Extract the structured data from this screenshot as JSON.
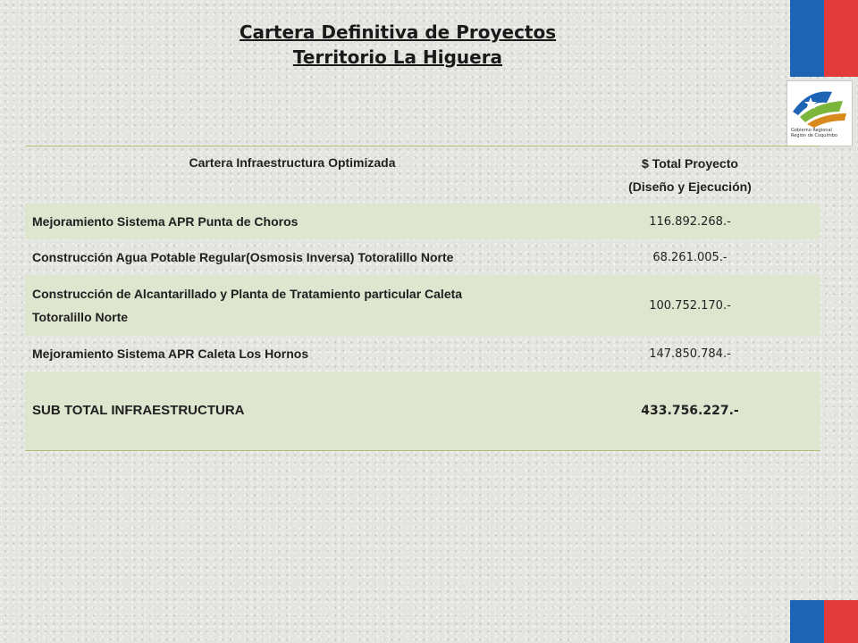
{
  "title": {
    "line1": "Cartera Definitiva de Proyectos",
    "line2": "Territorio La Higuera"
  },
  "logo": {
    "icon": "gobierno-regional-logo",
    "text": "Gobierno Regional Región de Coquimbo"
  },
  "colors": {
    "flag_blue": "#1d64b4",
    "flag_red": "#e23b3b",
    "row_shade": "#dfe6cf",
    "border": "#a9c07b"
  },
  "table": {
    "headers": {
      "name": "Cartera Infraestructura Optimizada",
      "value_line1": "$ Total Proyecto",
      "value_line2": "(Diseño y Ejecución)"
    },
    "rows": [
      {
        "name": "Mejoramiento Sistema APR Punta de Choros",
        "value": "116.892.268.-"
      },
      {
        "name": "Construcción Agua Potable Regular(Osmosis Inversa) Totoralillo Norte",
        "value": "68.261.005.-"
      },
      {
        "name_line1": "Construcción de Alcantarillado y Planta de Tratamiento particular Caleta",
        "name_line2": "Totoralillo Norte",
        "value": "100.752.170.-"
      },
      {
        "name": "Mejoramiento Sistema APR Caleta Los Hornos",
        "value": "147.850.784.-"
      }
    ],
    "subtotal": {
      "name": "SUB TOTAL INFRAESTRUCTURA",
      "value": "433.756.227.-"
    }
  }
}
